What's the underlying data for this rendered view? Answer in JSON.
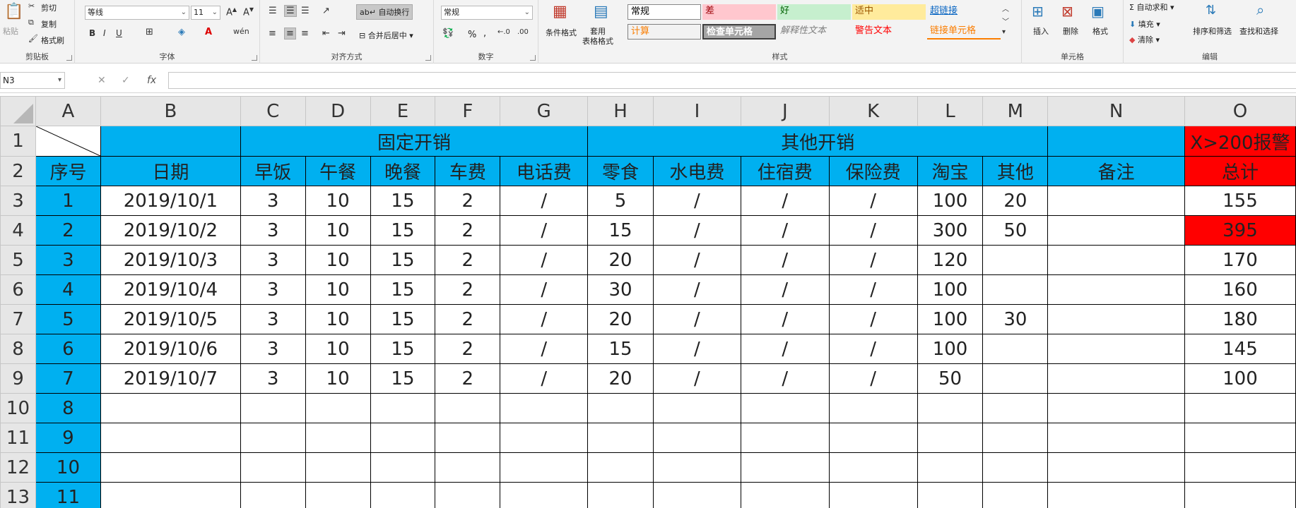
{
  "ribbon": {
    "clipboard": {
      "paste": "粘贴",
      "cut": "剪切",
      "copy": "复制",
      "format_painter": "格式刷",
      "label": "剪贴板"
    },
    "font": {
      "name": "等线",
      "size": "11",
      "bold": "B",
      "italic": "I",
      "underline": "U",
      "label": "字体"
    },
    "alignment": {
      "wrap": "自动换行",
      "merge": "合并后居中",
      "label": "对齐方式"
    },
    "number": {
      "format": "常规",
      "percent": "%",
      "comma": ",",
      "label": "数字"
    },
    "styles": {
      "cond_format": "条件格式",
      "table_format": "套用\n表格格式",
      "cells": [
        {
          "text": "常规",
          "bg": "#ffffff",
          "fg": "#000000"
        },
        {
          "text": "差",
          "bg": "#ffc7ce",
          "fg": "#9c0006"
        },
        {
          "text": "好",
          "bg": "#c6efce",
          "fg": "#006100"
        },
        {
          "text": "适中",
          "bg": "#ffeb9c",
          "fg": "#9c5700"
        },
        {
          "text": "超链接",
          "bg": "#f3f3f3",
          "fg": "#0563c1"
        },
        {
          "text": "计算",
          "bg": "#f2f2f2",
          "fg": "#fa7d00"
        },
        {
          "text": "检查单元格",
          "bg": "#a5a5a5",
          "fg": "#ffffff"
        },
        {
          "text": "解释性文本",
          "bg": "#f3f3f3",
          "fg": "#7f7f7f"
        },
        {
          "text": "警告文本",
          "bg": "#f3f3f3",
          "fg": "#ff0000"
        },
        {
          "text": "链接单元格",
          "bg": "#f3f3f3",
          "fg": "#fa7d00"
        }
      ],
      "label": "样式"
    },
    "cells_grp": {
      "insert": "插入",
      "delete": "删除",
      "format": "格式",
      "label": "单元格"
    },
    "editing": {
      "autosum": "自动求和",
      "fill": "填充",
      "clear": "清除",
      "sort": "排序和筛选",
      "find": "查找和选择",
      "label": "编辑"
    }
  },
  "formula_bar": {
    "name_box": "N3",
    "cancel": "✕",
    "enter": "✓",
    "fx": "fx",
    "content": ""
  },
  "sheet": {
    "columns": [
      "A",
      "B",
      "C",
      "D",
      "E",
      "F",
      "G",
      "H",
      "I",
      "J",
      "K",
      "L",
      "M",
      "N",
      "O"
    ],
    "rows": [
      "1",
      "2",
      "3",
      "4",
      "5",
      "6",
      "7",
      "8",
      "9",
      "10",
      "11",
      "12",
      "13"
    ],
    "group_fixed": "固定开销",
    "group_other": "其他开销",
    "alert": "X>200报警",
    "headers": [
      "序号",
      "日期",
      "早饭",
      "午餐",
      "晚餐",
      "车费",
      "电话费",
      "零食",
      "水电费",
      "住宿费",
      "保险费",
      "淘宝",
      "其他",
      "备注",
      "总计"
    ],
    "data": [
      [
        "1",
        "2019/10/1",
        "3",
        "10",
        "15",
        "2",
        "/",
        "5",
        "/",
        "/",
        "/",
        "100",
        "20",
        "",
        "155"
      ],
      [
        "2",
        "2019/10/2",
        "3",
        "10",
        "15",
        "2",
        "/",
        "15",
        "/",
        "/",
        "/",
        "300",
        "50",
        "",
        "395"
      ],
      [
        "3",
        "2019/10/3",
        "3",
        "10",
        "15",
        "2",
        "/",
        "20",
        "/",
        "/",
        "/",
        "120",
        "",
        "",
        "170"
      ],
      [
        "4",
        "2019/10/4",
        "3",
        "10",
        "15",
        "2",
        "/",
        "30",
        "/",
        "/",
        "/",
        "100",
        "",
        "",
        "160"
      ],
      [
        "5",
        "2019/10/5",
        "3",
        "10",
        "15",
        "2",
        "/",
        "20",
        "/",
        "/",
        "/",
        "100",
        "30",
        "",
        "180"
      ],
      [
        "6",
        "2019/10/6",
        "3",
        "10",
        "15",
        "2",
        "/",
        "15",
        "/",
        "/",
        "/",
        "100",
        "",
        "",
        "145"
      ],
      [
        "7",
        "2019/10/7",
        "3",
        "10",
        "15",
        "2",
        "/",
        "20",
        "/",
        "/",
        "/",
        "50",
        "",
        "",
        "100"
      ],
      [
        "8",
        "",
        "",
        "",
        "",
        "",
        "",
        "",
        "",
        "",
        "",
        "",
        "",
        "",
        ""
      ],
      [
        "9",
        "",
        "",
        "",
        "",
        "",
        "",
        "",
        "",
        "",
        "",
        "",
        "",
        "",
        ""
      ],
      [
        "10",
        "",
        "",
        "",
        "",
        "",
        "",
        "",
        "",
        "",
        "",
        "",
        "",
        "",
        ""
      ],
      [
        "11",
        "",
        "",
        "",
        "",
        "",
        "",
        "",
        "",
        "",
        "",
        "",
        "",
        "",
        ""
      ]
    ],
    "colors": {
      "header_blue": "#00b0f0",
      "alert_red": "#ff0000"
    }
  }
}
